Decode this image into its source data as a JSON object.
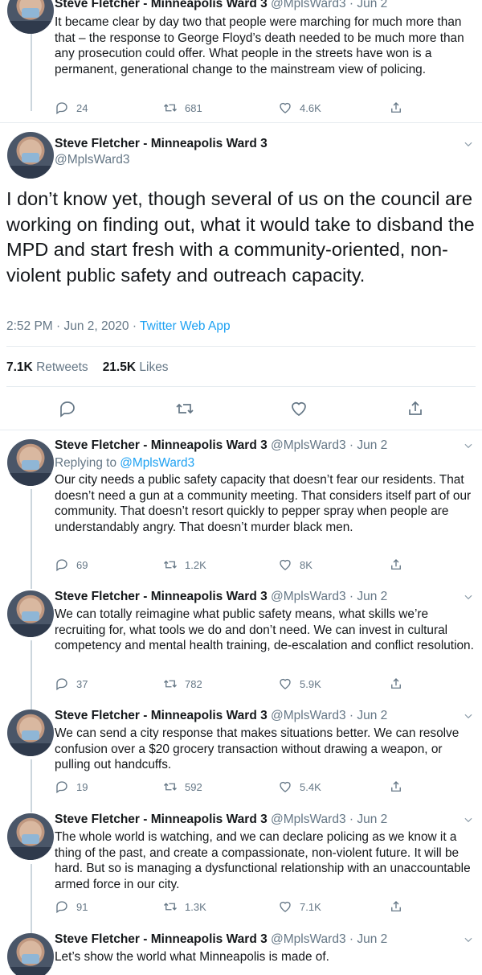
{
  "user": {
    "name": "Steve Fletcher - Minneapolis Ward 3",
    "handle": "@MplsWard3",
    "date": "Jun 2"
  },
  "top_tweet": {
    "text": "It became clear by day two that people were marching for much more than that – the response to George Floyd’s death needed to be much more than any prosecution could offer. What people in the streets have won is a permanent, generational change to the mainstream view of policing.",
    "replies": "24",
    "retweets": "681",
    "likes": "4.6K"
  },
  "main_tweet": {
    "text": "I don’t know yet, though several of us on the council are working on finding out, what it would take to disband the MPD and start fresh with a community-oriented, non-violent public safety and outreach capacity.",
    "time": "2:52 PM · Jun 2, 2020 · ",
    "app": "Twitter Web App",
    "retweet_count": "7.1K",
    "retweet_label": "Retweets",
    "like_count": "21.5K",
    "like_label": "Likes"
  },
  "replying": {
    "prefix": "Replying to ",
    "mention": "@MplsWard3"
  },
  "replies": [
    {
      "text": "Our city needs a public safety capacity that doesn’t fear our residents. That doesn’t need a gun at a community meeting. That considers itself part of our community. That doesn’t resort quickly to pepper spray when people are understandably angry. That doesn’t murder black men.",
      "replies": "69",
      "retweets": "1.2K",
      "likes": "8K"
    },
    {
      "text": "We can totally reimagine what public safety means, what skills we’re recruiting for, what tools we do and don’t need. We can invest in cultural competency and mental health training, de-escalation and conflict resolution.",
      "replies": "37",
      "retweets": "782",
      "likes": "5.9K"
    },
    {
      "text": "We can send a city response that makes situations better. We can resolve confusion over a $20 grocery transaction without drawing a weapon, or pulling out handcuffs.",
      "replies": "19",
      "retweets": "592",
      "likes": "5.4K"
    },
    {
      "text": "The whole world is watching, and we can declare policing as we know it a thing of the past, and create a compassionate, non-violent future. It will be hard. But so is managing a dysfunctional relationship with an unaccountable armed force in our city.",
      "replies": "91",
      "retweets": "1.3K",
      "likes": "7.1K"
    },
    {
      "text": "Let’s show the world what Minneapolis is made of."
    }
  ],
  "colors": {
    "link": "#1da1f2",
    "muted": "#657786",
    "divider": "#e6ecf0"
  },
  "icons": [
    "reply-icon",
    "retweet-icon",
    "like-icon",
    "share-icon",
    "chevron-down-icon"
  ]
}
